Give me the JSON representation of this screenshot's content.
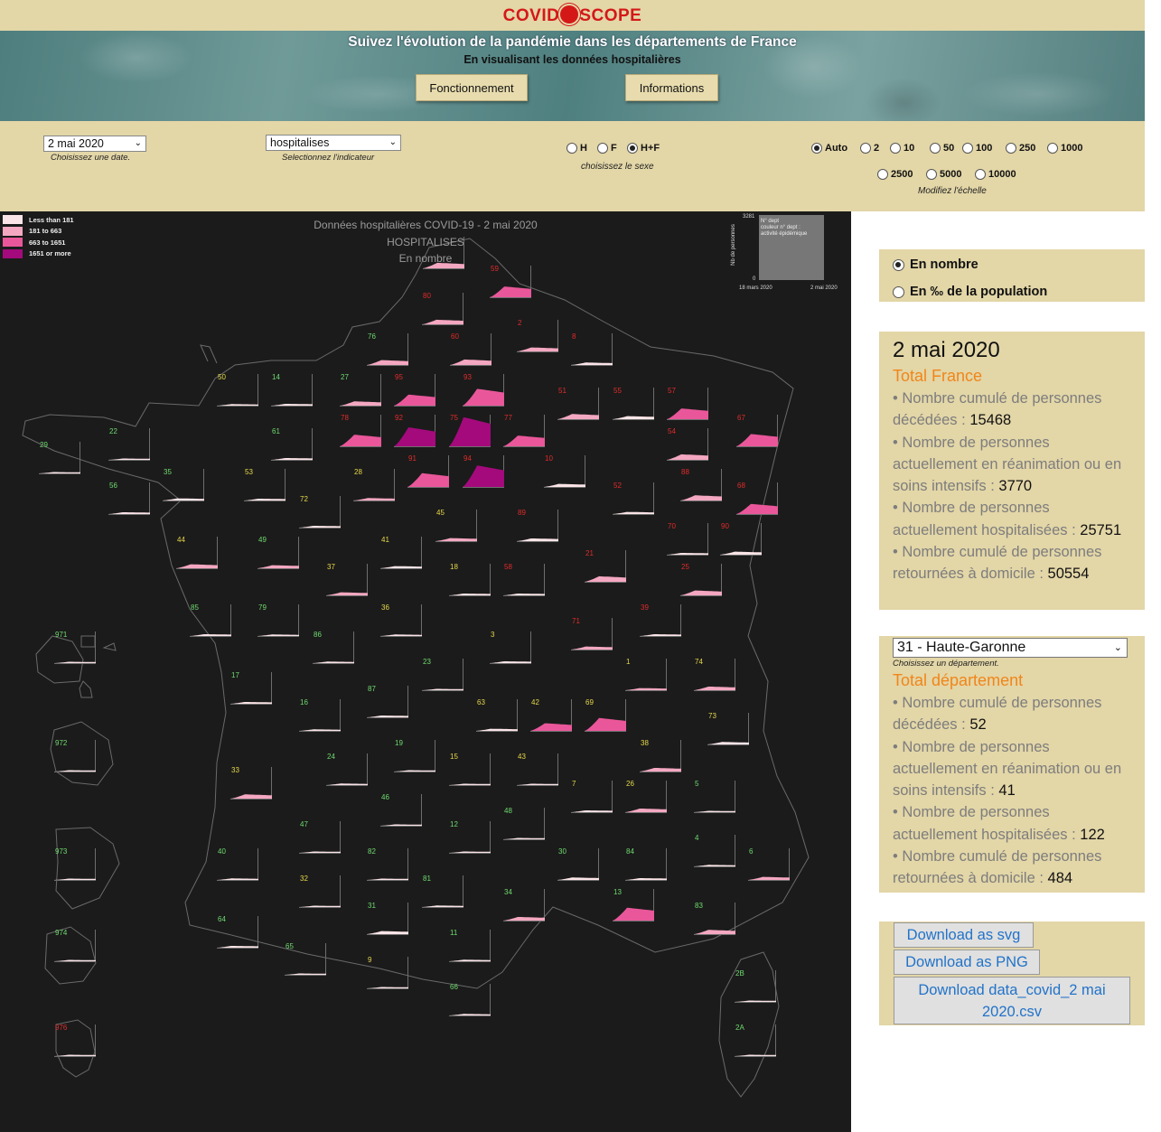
{
  "header": {
    "logo_left": "COVID",
    "logo_right": "SCOPE",
    "banner_title": "Suivez l'évolution de la pandémie dans les départements de France",
    "banner_subtitle": "En visualisant les données hospitalières",
    "btn_fonctionnement": "Fonctionnement",
    "btn_informations": "Informations"
  },
  "controls": {
    "date_value": "2 mai 2020",
    "date_caption": "Choisissez une date.",
    "indicator_value": "hospitalises",
    "indicator_caption": "Selectionnez l'indicateur",
    "sex_options": [
      {
        "label": "H",
        "selected": false
      },
      {
        "label": "F",
        "selected": false
      },
      {
        "label": "H+F",
        "selected": true
      }
    ],
    "sex_caption": "choisissez le sexe",
    "scale_options_row1": [
      {
        "label": "Auto",
        "selected": true
      },
      {
        "label": "2",
        "selected": false
      },
      {
        "label": "10",
        "selected": false
      },
      {
        "label": "50",
        "selected": false
      },
      {
        "label": "100",
        "selected": false
      },
      {
        "label": "250",
        "selected": false
      },
      {
        "label": "1000",
        "selected": false
      }
    ],
    "scale_options_row2": [
      {
        "label": "2500",
        "selected": false
      },
      {
        "label": "5000",
        "selected": false
      },
      {
        "label": "10000",
        "selected": false
      }
    ],
    "scale_caption": "Modifiez l'échelle"
  },
  "map": {
    "title_line1": "Données hospitalières COVID-19 - 2 mai 2020",
    "title_line2": "HOSPITALISES",
    "title_line3": "En nombre",
    "legend": [
      {
        "label": "Less than 181",
        "color": "#fbe4e7"
      },
      {
        "label": "181 to 663",
        "color": "#f4a7c0"
      },
      {
        "label": "663 to 1651",
        "color": "#e9579a"
      },
      {
        "label": "1651 or more",
        "color": "#a40a7c"
      }
    ],
    "mini": {
      "ymax": "3281",
      "ymin": "0",
      "ylabel": "Nb de personnes",
      "text1": "N° dept",
      "text2": "couleur n° dept :",
      "text3": "activité épidémique",
      "xstart": "18 mars 2020",
      "xend": "2 mai 2020"
    },
    "colors": {
      "green": "#6fdc6f",
      "yellow": "#e6d84a",
      "red": "#e02b2b"
    },
    "depts": [
      {
        "num": "",
        "c": "red",
        "lvl": 1,
        "h": 0.18
      },
      {
        "num": "59",
        "c": "red",
        "lvl": 2,
        "h": 0.35
      },
      {
        "num": "80",
        "c": "red",
        "lvl": 1,
        "h": 0.15
      },
      {
        "num": "2",
        "c": "red",
        "lvl": 1,
        "h": 0.13
      },
      {
        "num": "8",
        "c": "red",
        "lvl": 0,
        "h": 0.08
      },
      {
        "num": "76",
        "c": "green",
        "lvl": 1,
        "h": 0.16
      },
      {
        "num": "60",
        "c": "red",
        "lvl": 1,
        "h": 0.18
      },
      {
        "num": "50",
        "c": "yellow",
        "lvl": 0,
        "h": 0.05
      },
      {
        "num": "14",
        "c": "green",
        "lvl": 0,
        "h": 0.06
      },
      {
        "num": "27",
        "c": "green",
        "lvl": 1,
        "h": 0.14
      },
      {
        "num": "95",
        "c": "red",
        "lvl": 2,
        "h": 0.36
      },
      {
        "num": "93",
        "c": "red",
        "lvl": 2,
        "h": 0.55
      },
      {
        "num": "51",
        "c": "red",
        "lvl": 1,
        "h": 0.17
      },
      {
        "num": "55",
        "c": "red",
        "lvl": 0,
        "h": 0.1
      },
      {
        "num": "57",
        "c": "red",
        "lvl": 2,
        "h": 0.35
      },
      {
        "num": "29",
        "c": "green",
        "lvl": 0,
        "h": 0.04
      },
      {
        "num": "22",
        "c": "green",
        "lvl": 0,
        "h": 0.04
      },
      {
        "num": "61",
        "c": "green",
        "lvl": 0,
        "h": 0.06
      },
      {
        "num": "78",
        "c": "red",
        "lvl": 2,
        "h": 0.38
      },
      {
        "num": "92",
        "c": "red",
        "lvl": 3,
        "h": 0.62
      },
      {
        "num": "75",
        "c": "red",
        "lvl": 3,
        "h": 0.95
      },
      {
        "num": "77",
        "c": "red",
        "lvl": 2,
        "h": 0.35
      },
      {
        "num": "67",
        "c": "red",
        "lvl": 2,
        "h": 0.4
      },
      {
        "num": "54",
        "c": "red",
        "lvl": 1,
        "h": 0.18
      },
      {
        "num": "35",
        "c": "green",
        "lvl": 0,
        "h": 0.07
      },
      {
        "num": "53",
        "c": "yellow",
        "lvl": 0,
        "h": 0.06
      },
      {
        "num": "28",
        "c": "yellow",
        "lvl": 1,
        "h": 0.08
      },
      {
        "num": "91",
        "c": "red",
        "lvl": 2,
        "h": 0.45
      },
      {
        "num": "94",
        "c": "red",
        "lvl": 3,
        "h": 0.7
      },
      {
        "num": "10",
        "c": "red",
        "lvl": 0,
        "h": 0.1
      },
      {
        "num": "88",
        "c": "red",
        "lvl": 1,
        "h": 0.17
      },
      {
        "num": "56",
        "c": "green",
        "lvl": 0,
        "h": 0.06
      },
      {
        "num": "72",
        "c": "yellow",
        "lvl": 0,
        "h": 0.06
      },
      {
        "num": "52",
        "c": "red",
        "lvl": 0,
        "h": 0.07
      },
      {
        "num": "68",
        "c": "red",
        "lvl": 2,
        "h": 0.33
      },
      {
        "num": "45",
        "c": "yellow",
        "lvl": 1,
        "h": 0.1
      },
      {
        "num": "89",
        "c": "red",
        "lvl": 0,
        "h": 0.09
      },
      {
        "num": "70",
        "c": "red",
        "lvl": 0,
        "h": 0.06
      },
      {
        "num": "90",
        "c": "red",
        "lvl": 0,
        "h": 0.1
      },
      {
        "num": "44",
        "c": "yellow",
        "lvl": 1,
        "h": 0.13
      },
      {
        "num": "49",
        "c": "green",
        "lvl": 1,
        "h": 0.1
      },
      {
        "num": "41",
        "c": "yellow",
        "lvl": 0,
        "h": 0.07
      },
      {
        "num": "37",
        "c": "yellow",
        "lvl": 1,
        "h": 0.1
      },
      {
        "num": "18",
        "c": "yellow",
        "lvl": 0,
        "h": 0.06
      },
      {
        "num": "58",
        "c": "red",
        "lvl": 0,
        "h": 0.06
      },
      {
        "num": "21",
        "c": "red",
        "lvl": 1,
        "h": 0.18
      },
      {
        "num": "25",
        "c": "red",
        "lvl": 1,
        "h": 0.16
      },
      {
        "num": "85",
        "c": "green",
        "lvl": 0,
        "h": 0.06
      },
      {
        "num": "79",
        "c": "green",
        "lvl": 0,
        "h": 0.05
      },
      {
        "num": "36",
        "c": "yellow",
        "lvl": 0,
        "h": 0.05
      },
      {
        "num": "71",
        "c": "red",
        "lvl": 1,
        "h": 0.1
      },
      {
        "num": "39",
        "c": "red",
        "lvl": 0,
        "h": 0.06
      },
      {
        "num": "971",
        "c": "green",
        "lvl": 0,
        "h": 0.04
      },
      {
        "num": "86",
        "c": "green",
        "lvl": 0,
        "h": 0.05
      },
      {
        "num": "3",
        "c": "yellow",
        "lvl": 0,
        "h": 0.06
      },
      {
        "num": "23",
        "c": "green",
        "lvl": 0,
        "h": 0.04
      },
      {
        "num": "1",
        "c": "yellow",
        "lvl": 1,
        "h": 0.07
      },
      {
        "num": "74",
        "c": "yellow",
        "lvl": 1,
        "h": 0.12
      },
      {
        "num": "17",
        "c": "green",
        "lvl": 0,
        "h": 0.06
      },
      {
        "num": "16",
        "c": "green",
        "lvl": 0,
        "h": 0.05
      },
      {
        "num": "87",
        "c": "green",
        "lvl": 0,
        "h": 0.06
      },
      {
        "num": "63",
        "c": "yellow",
        "lvl": 0,
        "h": 0.07
      },
      {
        "num": "42",
        "c": "yellow",
        "lvl": 2,
        "h": 0.25
      },
      {
        "num": "69",
        "c": "yellow",
        "lvl": 2,
        "h": 0.42
      },
      {
        "num": "73",
        "c": "yellow",
        "lvl": 0,
        "h": 0.08
      },
      {
        "num": "972",
        "c": "green",
        "lvl": 0,
        "h": 0.04
      },
      {
        "num": "19",
        "c": "green",
        "lvl": 0,
        "h": 0.04
      },
      {
        "num": "24",
        "c": "green",
        "lvl": 0,
        "h": 0.05
      },
      {
        "num": "15",
        "c": "yellow",
        "lvl": 0,
        "h": 0.03
      },
      {
        "num": "43",
        "c": "yellow",
        "lvl": 0,
        "h": 0.04
      },
      {
        "num": "38",
        "c": "yellow",
        "lvl": 1,
        "h": 0.12
      },
      {
        "num": "33",
        "c": "yellow",
        "lvl": 1,
        "h": 0.14
      },
      {
        "num": "7",
        "c": "yellow",
        "lvl": 0,
        "h": 0.06
      },
      {
        "num": "26",
        "c": "yellow",
        "lvl": 1,
        "h": 0.12
      },
      {
        "num": "5",
        "c": "green",
        "lvl": 0,
        "h": 0.04
      },
      {
        "num": "46",
        "c": "green",
        "lvl": 0,
        "h": 0.03
      },
      {
        "num": "47",
        "c": "green",
        "lvl": 0,
        "h": 0.04
      },
      {
        "num": "12",
        "c": "green",
        "lvl": 0,
        "h": 0.04
      },
      {
        "num": "48",
        "c": "green",
        "lvl": 0,
        "h": 0.03
      },
      {
        "num": "4",
        "c": "green",
        "lvl": 0,
        "h": 0.05
      },
      {
        "num": "973",
        "c": "green",
        "lvl": 0,
        "h": 0.04
      },
      {
        "num": "40",
        "c": "green",
        "lvl": 0,
        "h": 0.05
      },
      {
        "num": "82",
        "c": "green",
        "lvl": 0,
        "h": 0.04
      },
      {
        "num": "30",
        "c": "green",
        "lvl": 0,
        "h": 0.08
      },
      {
        "num": "84",
        "c": "green",
        "lvl": 0,
        "h": 0.06
      },
      {
        "num": "6",
        "c": "green",
        "lvl": 1,
        "h": 0.1
      },
      {
        "num": "32",
        "c": "yellow",
        "lvl": 0,
        "h": 0.04
      },
      {
        "num": "81",
        "c": "green",
        "lvl": 0,
        "h": 0.05
      },
      {
        "num": "64",
        "c": "green",
        "lvl": 0,
        "h": 0.06
      },
      {
        "num": "31",
        "c": "green",
        "lvl": 0,
        "h": 0.1
      },
      {
        "num": "34",
        "c": "green",
        "lvl": 1,
        "h": 0.12
      },
      {
        "num": "13",
        "c": "green",
        "lvl": 2,
        "h": 0.42
      },
      {
        "num": "83",
        "c": "green",
        "lvl": 1,
        "h": 0.14
      },
      {
        "num": "974",
        "c": "green",
        "lvl": 0,
        "h": 0.04
      },
      {
        "num": "65",
        "c": "green",
        "lvl": 0,
        "h": 0.04
      },
      {
        "num": "11",
        "c": "green",
        "lvl": 0,
        "h": 0.05
      },
      {
        "num": "9",
        "c": "yellow",
        "lvl": 0,
        "h": 0.03
      },
      {
        "num": "66",
        "c": "green",
        "lvl": 0,
        "h": 0.05
      },
      {
        "num": "2B",
        "c": "green",
        "lvl": 0,
        "h": 0.04
      },
      {
        "num": "2A",
        "c": "green",
        "lvl": 0,
        "h": 0.04
      },
      {
        "num": "976",
        "c": "red",
        "lvl": 0,
        "h": 0.04
      }
    ]
  },
  "units": {
    "options": [
      {
        "label": "En nombre",
        "selected": true
      },
      {
        "label": "En ‰ de la population",
        "selected": false
      }
    ]
  },
  "france": {
    "date": "2 mai 2020",
    "title": "Total France",
    "deaths_label": "• Nombre cumulé de personnes décédées : ",
    "deaths_value": "15468",
    "rea_label": "• Nombre de personnes actuellement en réanimation ou en soins intensifs : ",
    "rea_value": "3770",
    "hosp_label": "• Nombre de personnes actuellement hospitalisées : ",
    "hosp_value": "25751",
    "home_label": "• Nombre cumulé de personnes retournées à domicile : ",
    "home_value": "50554"
  },
  "department": {
    "selected": "31 - Haute-Garonne",
    "caption": "Choisissez un département.",
    "title": "Total département",
    "deaths_label": "• Nombre cumulé de personnes décédées : ",
    "deaths_value": "52",
    "rea_label": "• Nombre de personnes actuellement en réanimation ou en soins intensifs : ",
    "rea_value": "41",
    "hosp_label": "• Nombre de personnes actuellement hospitalisées : ",
    "hosp_value": "122",
    "home_label": "• Nombre cumulé de personnes retournées à domicile : ",
    "home_value": "484"
  },
  "downloads": {
    "svg": "Download as svg",
    "png": "Download as PNG",
    "csv": "Download data_covid_2 mai 2020.csv"
  }
}
